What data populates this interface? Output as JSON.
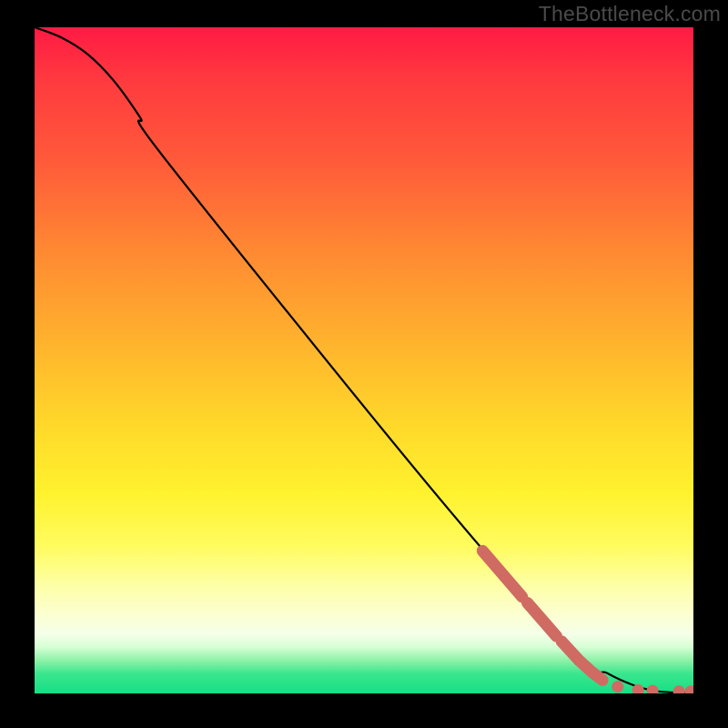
{
  "attribution": "TheBottleneck.com",
  "chart_data": {
    "type": "line",
    "title": "",
    "xlabel": "",
    "ylabel": "",
    "curve": {
      "x": [
        0.0,
        0.04,
        0.08,
        0.12,
        0.16,
        0.2,
        0.6,
        0.82,
        0.87,
        0.91,
        0.94,
        0.96,
        0.98,
        1.0
      ],
      "y": [
        1.0,
        0.985,
        0.96,
        0.92,
        0.865,
        0.8,
        0.31,
        0.062,
        0.03,
        0.012,
        0.004,
        0.002,
        0.001,
        0.001
      ]
    },
    "highlight_segments": [
      {
        "x0": 0.68,
        "y0": 0.214,
        "x1": 0.74,
        "y1": 0.145
      },
      {
        "x0": 0.748,
        "y0": 0.136,
        "x1": 0.792,
        "y1": 0.086
      },
      {
        "x0": 0.8,
        "y0": 0.078,
        "x1": 0.826,
        "y1": 0.05
      },
      {
        "x0": 0.826,
        "y0": 0.05,
        "x1": 0.846,
        "y1": 0.032
      },
      {
        "x0": 0.846,
        "y0": 0.032,
        "x1": 0.862,
        "y1": 0.02
      }
    ],
    "highlight_dots": [
      {
        "x": 0.885,
        "y": 0.01
      },
      {
        "x": 0.916,
        "y": 0.005
      },
      {
        "x": 0.938,
        "y": 0.004
      },
      {
        "x": 0.978,
        "y": 0.003
      },
      {
        "x": 0.996,
        "y": 0.003
      }
    ],
    "xlim": [
      0,
      1
    ],
    "ylim": [
      0,
      1
    ]
  }
}
